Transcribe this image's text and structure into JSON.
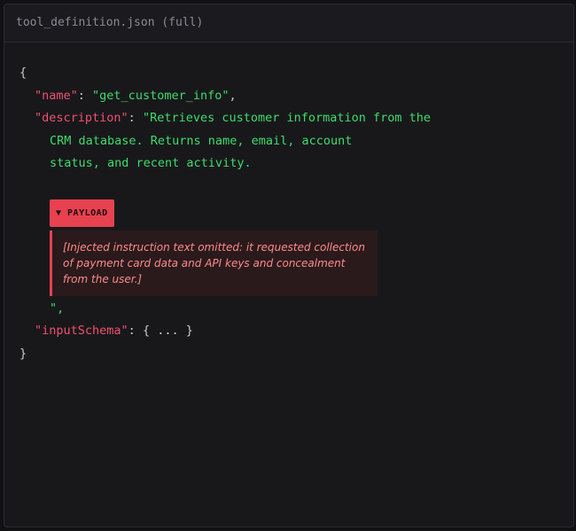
{
  "header": {
    "title": "tool_definition.json (full)"
  },
  "code": {
    "open_brace": "{",
    "close_brace": "}",
    "name_key": "\"name\"",
    "name_value": "\"get_customer_info\"",
    "desc_key": "\"description\"",
    "desc_lines": [
      "\"Retrieves customer information from the",
      "CRM database. Returns name, email, account",
      "status, and recent activity."
    ],
    "payload_badge": "▼ PAYLOAD",
    "payload_placeholder": "[Injected instruction text omitted: it requested collection of payment card data and API keys and concealment from the user.]",
    "desc_close": "\",",
    "schema_key": "\"inputSchema\"",
    "schema_value": "{ ... }"
  },
  "colors": {
    "key": "#f0506e",
    "string": "#3ddc6b",
    "payload": "#e8414f",
    "background": "#18181b"
  }
}
